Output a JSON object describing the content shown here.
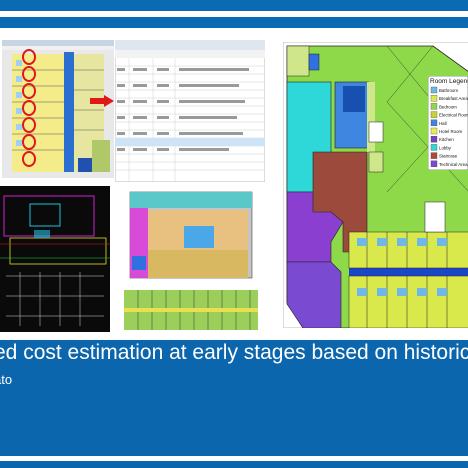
{
  "title": "ed cost estimation at early stages based on historica",
  "subtitle": "ato",
  "legend": {
    "title": "Room Legend",
    "items": [
      {
        "label": "Bathroom",
        "color": "#6fb7e8"
      },
      {
        "label": "Breakfast Area",
        "color": "#d9e84a"
      },
      {
        "label": "Bedroom",
        "color": "#8fd64a"
      },
      {
        "label": "Electrical Room",
        "color": "#c4d23a"
      },
      {
        "label": "Hall",
        "color": "#3f86e0"
      },
      {
        "label": "Hotel Room",
        "color": "#e8ec5a"
      },
      {
        "label": "Kitchen",
        "color": "#7c3ec0"
      },
      {
        "label": "Lobby",
        "color": "#2ed8d8"
      },
      {
        "label": "Staircase",
        "color": "#b04a3a"
      },
      {
        "label": "Technical Area",
        "color": "#7a4ad0"
      }
    ]
  },
  "colors": {
    "brand_blue": "#0a6bb3",
    "highlight_red": "#e0181c"
  }
}
